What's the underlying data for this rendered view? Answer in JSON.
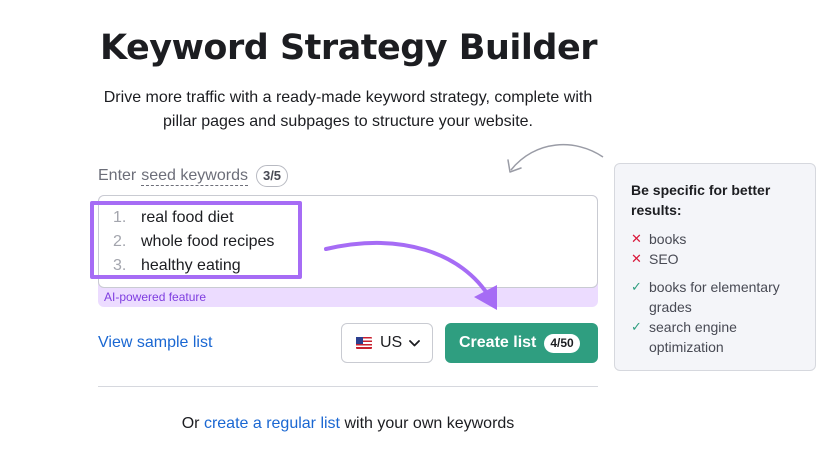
{
  "header": {
    "title": "Keyword Strategy Builder",
    "subtitle": "Drive more traffic with a ready-made keyword strategy, complete with pillar pages and subpages to structure your website."
  },
  "seed": {
    "label_prefix": "Enter",
    "label_link": "seed keywords",
    "count_badge": "3/5",
    "keywords": [
      {
        "num": "1.",
        "text": "real food diet"
      },
      {
        "num": "2.",
        "text": "whole food recipes"
      },
      {
        "num": "3.",
        "text": "healthy eating"
      }
    ],
    "ai_label": "AI-powered feature"
  },
  "actions": {
    "sample_link": "View sample list",
    "country": "US",
    "create_label": "Create list",
    "create_badge": "4/50"
  },
  "footer": {
    "prefix": "Or",
    "link": "create a regular list",
    "suffix": "with your own keywords"
  },
  "tips": {
    "title": "Be specific for better results:",
    "bad": [
      "books",
      "SEO"
    ],
    "good": [
      "books for elementary grades",
      "search engine optimization"
    ]
  },
  "colors": {
    "accent_green": "#2f9e80",
    "link_blue": "#1a67d2",
    "highlight_purple": "#a66cf5",
    "error_red": "#d9173a"
  },
  "icons": {
    "flag": "us-flag-icon",
    "chevron": "chevron-down-icon",
    "bad_mark": "cross-icon",
    "good_mark": "check-icon"
  }
}
